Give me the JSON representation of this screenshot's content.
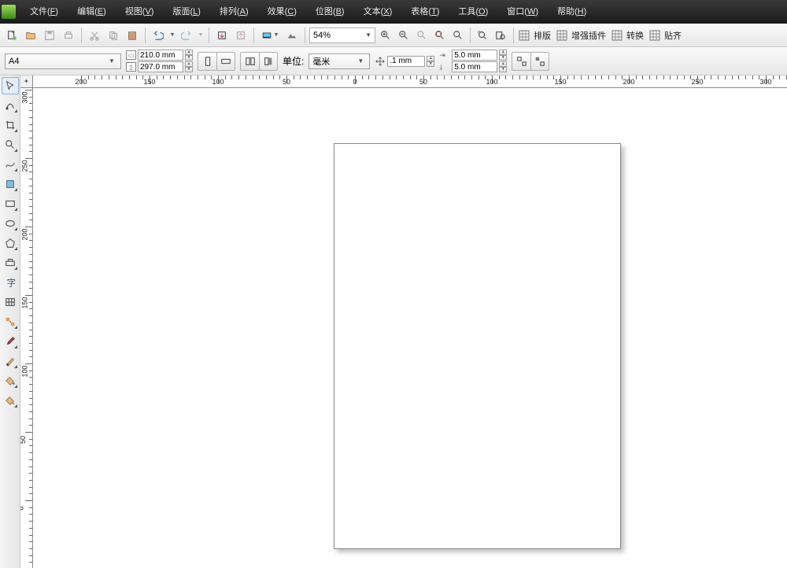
{
  "menu": [
    {
      "label": "文件",
      "key": "F"
    },
    {
      "label": "编辑",
      "key": "E"
    },
    {
      "label": "视图",
      "key": "V"
    },
    {
      "label": "版面",
      "key": "L"
    },
    {
      "label": "排列",
      "key": "A"
    },
    {
      "label": "效果",
      "key": "C"
    },
    {
      "label": "位图",
      "key": "B"
    },
    {
      "label": "文本",
      "key": "X"
    },
    {
      "label": "表格",
      "key": "T"
    },
    {
      "label": "工具",
      "key": "O"
    },
    {
      "label": "窗口",
      "key": "W"
    },
    {
      "label": "帮助",
      "key": "H"
    }
  ],
  "toolbar_right": [
    {
      "label": "排版",
      "name": "layout-group"
    },
    {
      "label": "增强插件",
      "name": "plugin-group"
    },
    {
      "label": "转换",
      "name": "convert-group"
    },
    {
      "label": "贴齐",
      "name": "snap-group"
    }
  ],
  "zoom": "54%",
  "prop": {
    "paper": "A4",
    "w": "210.0 mm",
    "h": "297.0 mm",
    "unit_label": "单位:",
    "unit_value": "毫米",
    "nudge": ".1 mm",
    "dupx": "5.0 mm",
    "dupy": "5.0 mm"
  },
  "ruler_h": [
    {
      "pos": 77,
      "label": "200"
    },
    {
      "pos": 164,
      "label": "150"
    },
    {
      "pos": 251,
      "label": "100"
    },
    {
      "pos": 338,
      "label": "50"
    },
    {
      "pos": 425,
      "label": "0"
    },
    {
      "pos": 512,
      "label": "50"
    },
    {
      "pos": 599,
      "label": "100"
    },
    {
      "pos": 686,
      "label": "150"
    },
    {
      "pos": 773,
      "label": "200"
    },
    {
      "pos": 860,
      "label": "250"
    },
    {
      "pos": 947,
      "label": "300"
    }
  ],
  "ruler_v": [
    {
      "pos": 2,
      "label": "300"
    },
    {
      "pos": 89,
      "label": "250"
    },
    {
      "pos": 176,
      "label": "200"
    },
    {
      "pos": 263,
      "label": "150"
    },
    {
      "pos": 350,
      "label": "100"
    },
    {
      "pos": 437,
      "label": "50"
    },
    {
      "pos": 524,
      "label": "0"
    }
  ]
}
